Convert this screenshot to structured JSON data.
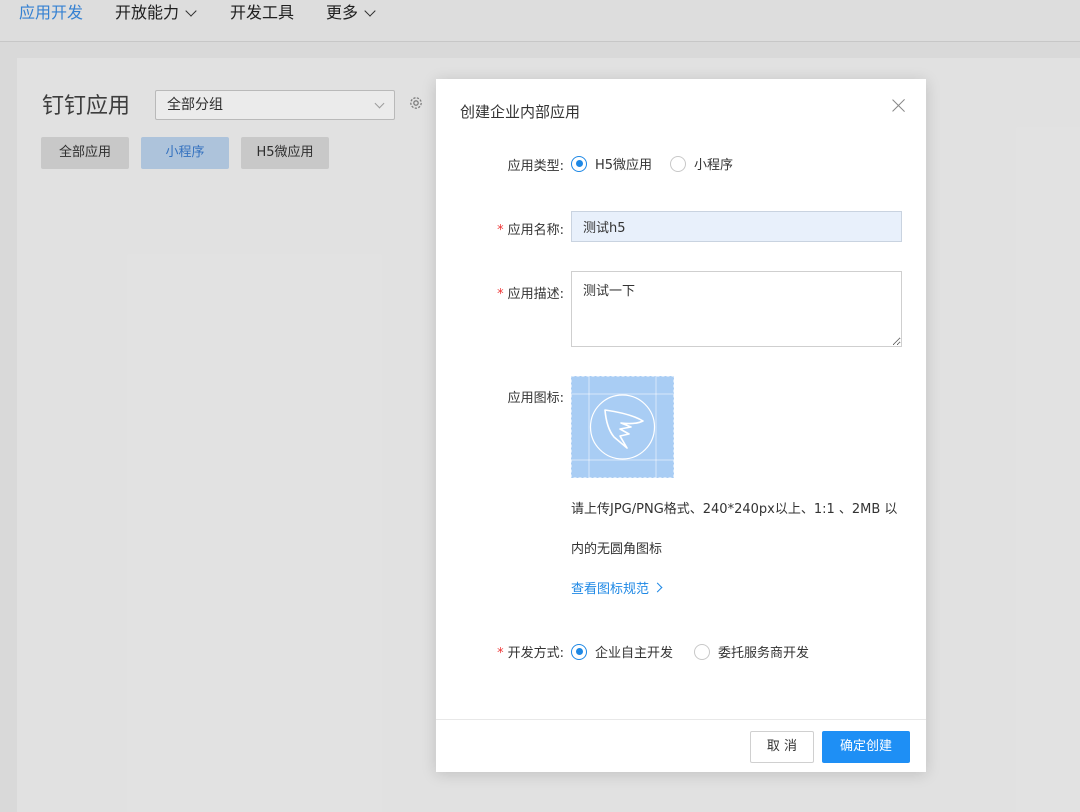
{
  "topnav": {
    "items": [
      {
        "label": "应用开发",
        "active": true
      },
      {
        "label": "开放能力",
        "dropdown": true
      },
      {
        "label": "开发工具"
      },
      {
        "label": "更多",
        "dropdown": true
      }
    ]
  },
  "page": {
    "title": "钉钉应用",
    "group_select": "全部分组",
    "tabs": [
      {
        "label": "全部应用"
      },
      {
        "label": "小程序",
        "active": true
      },
      {
        "label": "H5微应用"
      }
    ]
  },
  "modal": {
    "title": "创建企业内部应用",
    "app_type": {
      "label": "应用类型:",
      "options": [
        {
          "label": "H5微应用",
          "selected": true
        },
        {
          "label": "小程序",
          "selected": false
        }
      ]
    },
    "app_name": {
      "label": "应用名称:",
      "value": "测试h5"
    },
    "app_desc": {
      "label": "应用描述:",
      "value": "测试一下"
    },
    "app_icon": {
      "label": "应用图标:",
      "hint_line1": "请上传JPG/PNG格式、240*240px以上、1:1 、2MB 以",
      "hint_line2": "内的无圆角图标",
      "spec_link": "查看图标规范"
    },
    "dev_mode": {
      "label": "开发方式:",
      "options": [
        {
          "label": "企业自主开发",
          "selected": true
        },
        {
          "label": "委托服务商开发",
          "selected": false
        }
      ]
    },
    "cancel_label": "取 消",
    "confirm_label": "确定创建"
  },
  "colors": {
    "accent": "#1e8ff5",
    "active_nav": "#3a8ce4",
    "required": "#e33333",
    "input_bg": "#e8f0fb",
    "icon_bg": "#a9cdf4"
  }
}
